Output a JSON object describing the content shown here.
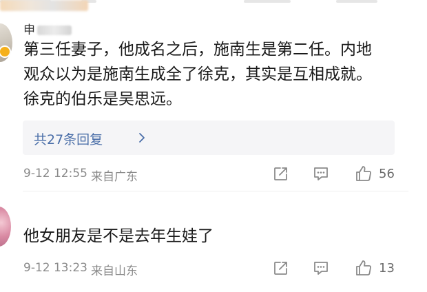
{
  "comments": [
    {
      "username_visible": "申",
      "text": "第三任妻子，他成名之后，施南生是第二任。内地\n观众以为是施南生成全了徐克，其实是互相成就。\n徐克的伯乐是吴思远。",
      "replies_label": "共27条回复",
      "time": "9-12 12:55",
      "location": "来自广东",
      "likes": "56"
    },
    {
      "text": "他女朋友是不是去年生娃了",
      "time": "9-12 13:23",
      "location": "来自山东",
      "likes": "13"
    }
  ],
  "icons": {
    "share": "share-icon",
    "comment": "comment-icon",
    "like": "thumbs-up-icon",
    "replies_arrow": "chevron-right-icon",
    "verified_badge": "verified-badge-icon"
  },
  "colors": {
    "link": "#4a6ea8",
    "meta": "#8a8a8a",
    "text": "#1a1a1a",
    "replies_bg": "#f5f5f7",
    "badge": "#f5b01b"
  }
}
